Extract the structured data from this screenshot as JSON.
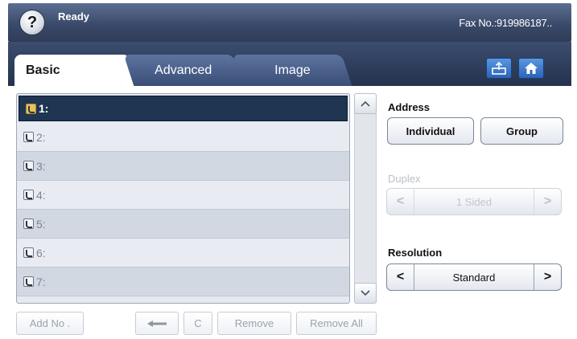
{
  "header": {
    "help_glyph": "?",
    "status": "Ready",
    "fax_number": "Fax No.:919986187.."
  },
  "tabs": [
    {
      "label": "Basic",
      "active": true
    },
    {
      "label": "Advanced",
      "active": false
    },
    {
      "label": "Image",
      "active": false
    }
  ],
  "toolbar_icons": {
    "tray": "tray-icon",
    "home": "home-icon"
  },
  "number_list": {
    "rows": [
      {
        "label": "1:",
        "selected": true
      },
      {
        "label": "2:",
        "selected": false
      },
      {
        "label": "3:",
        "selected": false
      },
      {
        "label": "4:",
        "selected": false
      },
      {
        "label": "5:",
        "selected": false
      },
      {
        "label": "6:",
        "selected": false
      },
      {
        "label": "7:",
        "selected": false
      }
    ],
    "scroll_up": "^",
    "scroll_down": "v"
  },
  "actions": {
    "add_no": "Add No .",
    "backspace": "⟵",
    "clear": "C",
    "remove": "Remove",
    "remove_all": "Remove All"
  },
  "address": {
    "label": "Address",
    "individual": "Individual",
    "group": "Group"
  },
  "duplex": {
    "label": "Duplex",
    "value": "1 Sided",
    "prev": "<",
    "next": ">"
  },
  "resolution": {
    "label": "Resolution",
    "value": "Standard",
    "prev": "<",
    "next": ">"
  },
  "colors": {
    "header_bg": "#3b4a6a",
    "selected_row": "#1f3552",
    "accent_button": "#2c63b8"
  }
}
